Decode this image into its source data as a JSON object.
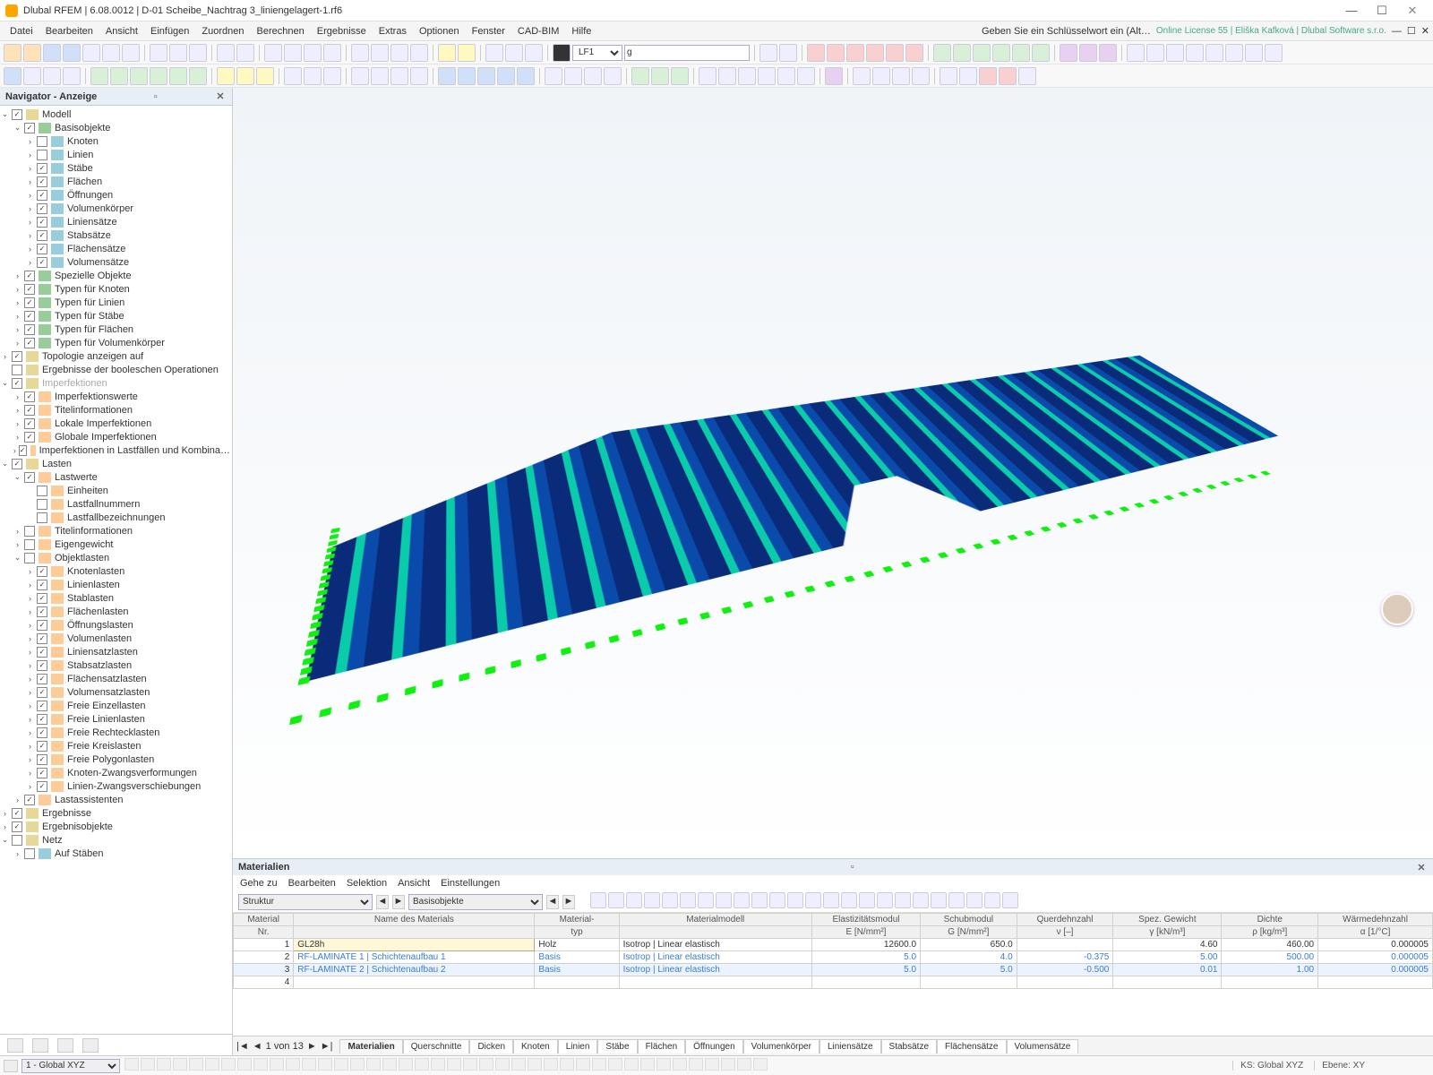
{
  "title": "Dlubal RFEM | 6.08.0012 | D-01 Scheibe_Nachtrag 3_liniengelagert-1.rf6",
  "license_prompt": "Geben Sie ein Schlüsselwort ein (Alt…",
  "license": "Online License 55 | Eliška Kafková | Dlubal Software s.r.o.",
  "menu": [
    "Datei",
    "Bearbeiten",
    "Ansicht",
    "Einfügen",
    "Zuordnen",
    "Berechnen",
    "Ergebnisse",
    "Extras",
    "Optionen",
    "Fenster",
    "CAD-BIM",
    "Hilfe"
  ],
  "lf_label": "LF1",
  "lf_filter": "g",
  "nav_title": "Navigator - Anzeige",
  "tree": [
    {
      "l": 0,
      "ex": "v",
      "ck": 1,
      "ic": "f",
      "t": "Modell"
    },
    {
      "l": 1,
      "ex": "v",
      "ck": 1,
      "ic": "g",
      "t": "Basisobjekte"
    },
    {
      "l": 2,
      "ex": ">",
      "ck": 0,
      "ic": "b",
      "t": "Knoten"
    },
    {
      "l": 2,
      "ex": ">",
      "ck": 0,
      "ic": "b",
      "t": "Linien"
    },
    {
      "l": 2,
      "ex": ">",
      "ck": 1,
      "ic": "b",
      "t": "Stäbe"
    },
    {
      "l": 2,
      "ex": ">",
      "ck": 1,
      "ic": "b",
      "t": "Flächen"
    },
    {
      "l": 2,
      "ex": ">",
      "ck": 1,
      "ic": "b",
      "t": "Öffnungen"
    },
    {
      "l": 2,
      "ex": ">",
      "ck": 1,
      "ic": "b",
      "t": "Volumenkörper"
    },
    {
      "l": 2,
      "ex": ">",
      "ck": 1,
      "ic": "b",
      "t": "Liniensätze"
    },
    {
      "l": 2,
      "ex": ">",
      "ck": 1,
      "ic": "b",
      "t": "Stabsätze"
    },
    {
      "l": 2,
      "ex": ">",
      "ck": 1,
      "ic": "b",
      "t": "Flächensätze"
    },
    {
      "l": 2,
      "ex": ">",
      "ck": 1,
      "ic": "b",
      "t": "Volumensätze"
    },
    {
      "l": 1,
      "ex": ">",
      "ck": 1,
      "ic": "g",
      "t": "Spezielle Objekte"
    },
    {
      "l": 1,
      "ex": ">",
      "ck": 1,
      "ic": "g",
      "t": "Typen für Knoten"
    },
    {
      "l": 1,
      "ex": ">",
      "ck": 1,
      "ic": "g",
      "t": "Typen für Linien"
    },
    {
      "l": 1,
      "ex": ">",
      "ck": 1,
      "ic": "g",
      "t": "Typen für Stäbe"
    },
    {
      "l": 1,
      "ex": ">",
      "ck": 1,
      "ic": "g",
      "t": "Typen für Flächen"
    },
    {
      "l": 1,
      "ex": ">",
      "ck": 1,
      "ic": "g",
      "t": "Typen für Volumenkörper"
    },
    {
      "l": 0,
      "ex": ">",
      "ck": 1,
      "ic": "f",
      "t": "Topologie anzeigen auf"
    },
    {
      "l": 0,
      "ex": "",
      "ck": 0,
      "ic": "f",
      "t": "Ergebnisse der booleschen Operationen"
    },
    {
      "l": 0,
      "ex": "v",
      "ck": 1,
      "ic": "f",
      "t": "Imperfektionen",
      "dim": 1
    },
    {
      "l": 1,
      "ex": ">",
      "ck": 1,
      "ic": "o",
      "t": "Imperfektionswerte"
    },
    {
      "l": 1,
      "ex": ">",
      "ck": 1,
      "ic": "o",
      "t": "Titelinformationen"
    },
    {
      "l": 1,
      "ex": ">",
      "ck": 1,
      "ic": "o",
      "t": "Lokale Imperfektionen"
    },
    {
      "l": 1,
      "ex": ">",
      "ck": 1,
      "ic": "o",
      "t": "Globale Imperfektionen"
    },
    {
      "l": 1,
      "ex": ">",
      "ck": 1,
      "ic": "o",
      "t": "Imperfektionen in Lastfällen und Kombina…"
    },
    {
      "l": 0,
      "ex": "v",
      "ck": 1,
      "ic": "f",
      "t": "Lasten"
    },
    {
      "l": 1,
      "ex": "v",
      "ck": 1,
      "ic": "o",
      "t": "Lastwerte"
    },
    {
      "l": 2,
      "ex": "",
      "ck": 0,
      "ic": "o",
      "t": "Einheiten"
    },
    {
      "l": 2,
      "ex": "",
      "ck": 0,
      "ic": "o",
      "t": "Lastfallnummern"
    },
    {
      "l": 2,
      "ex": "",
      "ck": 0,
      "ic": "o",
      "t": "Lastfallbezeichnungen"
    },
    {
      "l": 1,
      "ex": ">",
      "ck": 0,
      "ic": "o",
      "t": "Titelinformationen"
    },
    {
      "l": 1,
      "ex": ">",
      "ck": 0,
      "ic": "o",
      "t": "Eigengewicht"
    },
    {
      "l": 1,
      "ex": "v",
      "ck": 0,
      "ic": "o",
      "t": "Objektlasten"
    },
    {
      "l": 2,
      "ex": ">",
      "ck": 1,
      "ic": "o",
      "t": "Knotenlasten"
    },
    {
      "l": 2,
      "ex": ">",
      "ck": 1,
      "ic": "o",
      "t": "Linienlasten"
    },
    {
      "l": 2,
      "ex": ">",
      "ck": 1,
      "ic": "o",
      "t": "Stablasten"
    },
    {
      "l": 2,
      "ex": ">",
      "ck": 1,
      "ic": "o",
      "t": "Flächenlasten"
    },
    {
      "l": 2,
      "ex": ">",
      "ck": 1,
      "ic": "o",
      "t": "Öffnungslasten"
    },
    {
      "l": 2,
      "ex": ">",
      "ck": 1,
      "ic": "o",
      "t": "Volumenlasten"
    },
    {
      "l": 2,
      "ex": ">",
      "ck": 1,
      "ic": "o",
      "t": "Liniensatzlasten"
    },
    {
      "l": 2,
      "ex": ">",
      "ck": 1,
      "ic": "o",
      "t": "Stabsatzlasten"
    },
    {
      "l": 2,
      "ex": ">",
      "ck": 1,
      "ic": "o",
      "t": "Flächensatzlasten"
    },
    {
      "l": 2,
      "ex": ">",
      "ck": 1,
      "ic": "o",
      "t": "Volumensatzlasten"
    },
    {
      "l": 2,
      "ex": ">",
      "ck": 1,
      "ic": "o",
      "t": "Freie Einzellasten"
    },
    {
      "l": 2,
      "ex": ">",
      "ck": 1,
      "ic": "o",
      "t": "Freie Linienlasten"
    },
    {
      "l": 2,
      "ex": ">",
      "ck": 1,
      "ic": "o",
      "t": "Freie Rechtecklasten"
    },
    {
      "l": 2,
      "ex": ">",
      "ck": 1,
      "ic": "o",
      "t": "Freie Kreislasten"
    },
    {
      "l": 2,
      "ex": ">",
      "ck": 1,
      "ic": "o",
      "t": "Freie Polygonlasten"
    },
    {
      "l": 2,
      "ex": ">",
      "ck": 1,
      "ic": "o",
      "t": "Knoten-Zwangsverformungen"
    },
    {
      "l": 2,
      "ex": ">",
      "ck": 1,
      "ic": "o",
      "t": "Linien-Zwangsverschiebungen"
    },
    {
      "l": 1,
      "ex": ">",
      "ck": 1,
      "ic": "o",
      "t": "Lastassistenten"
    },
    {
      "l": 0,
      "ex": ">",
      "ck": 1,
      "ic": "f",
      "t": "Ergebnisse"
    },
    {
      "l": 0,
      "ex": ">",
      "ck": 1,
      "ic": "f",
      "t": "Ergebnisobjekte"
    },
    {
      "l": 0,
      "ex": "v",
      "ck": 0,
      "ic": "f",
      "t": "Netz"
    },
    {
      "l": 1,
      "ex": ">",
      "ck": 0,
      "ic": "b",
      "t": "Auf Stäben"
    }
  ],
  "mat_title": "Materialien",
  "mat_menu": [
    "Gehe zu",
    "Bearbeiten",
    "Selektion",
    "Ansicht",
    "Einstellungen"
  ],
  "mat_sel1": "Struktur",
  "mat_sel2": "Basisobjekte",
  "cols1": [
    "Material",
    "Name des Materials",
    "Material-",
    "Materialmodell",
    "Elastizitätsmodul",
    "Schubmodul",
    "Querdehnzahl",
    "Spez. Gewicht",
    "Dichte",
    "Wärmedehnzahl"
  ],
  "cols2": [
    "Nr.",
    "",
    "typ",
    "",
    "E [N/mm²]",
    "G [N/mm²]",
    "ν [–]",
    "γ [kN/m³]",
    "ρ [kg/m³]",
    "α [1/°C]"
  ],
  "rows": [
    {
      "nr": "1",
      "name": "GL28h",
      "typ": "Holz",
      "model": "Isotrop | Linear elastisch",
      "E": "12600.0",
      "G": "650.0",
      "v": "",
      "y": "4.60",
      "p": "460.00",
      "a": "0.000005"
    },
    {
      "nr": "2",
      "name": "RF-LAMINATE 1 | Schichtenaufbau 1",
      "typ": "Basis",
      "model": "Isotrop | Linear elastisch",
      "E": "5.0",
      "G": "4.0",
      "v": "-0.375",
      "y": "5.00",
      "p": "500.00",
      "a": "0.000005",
      "link": 1
    },
    {
      "nr": "3",
      "name": "RF-LAMINATE 2 | Schichtenaufbau 2",
      "typ": "Basis",
      "model": "Isotrop | Linear elastisch",
      "E": "5.0",
      "G": "5.0",
      "v": "-0.500",
      "y": "0.01",
      "p": "1.00",
      "a": "0.000005",
      "link": 1,
      "hl": 1
    },
    {
      "nr": "4",
      "name": "",
      "typ": "",
      "model": "",
      "E": "",
      "G": "",
      "v": "",
      "y": "",
      "p": "",
      "a": ""
    }
  ],
  "pager": "1 von 13",
  "tab_list": [
    "Materialien",
    "Querschnitte",
    "Dicken",
    "Knoten",
    "Linien",
    "Stäbe",
    "Flächen",
    "Öffnungen",
    "Volumenkörper",
    "Liniensätze",
    "Stabsätze",
    "Flächensätze",
    "Volumensätze"
  ],
  "status_cs": "1 - Global XYZ",
  "status_ks": "KS: Global XYZ",
  "status_eb": "Ebene: XY"
}
